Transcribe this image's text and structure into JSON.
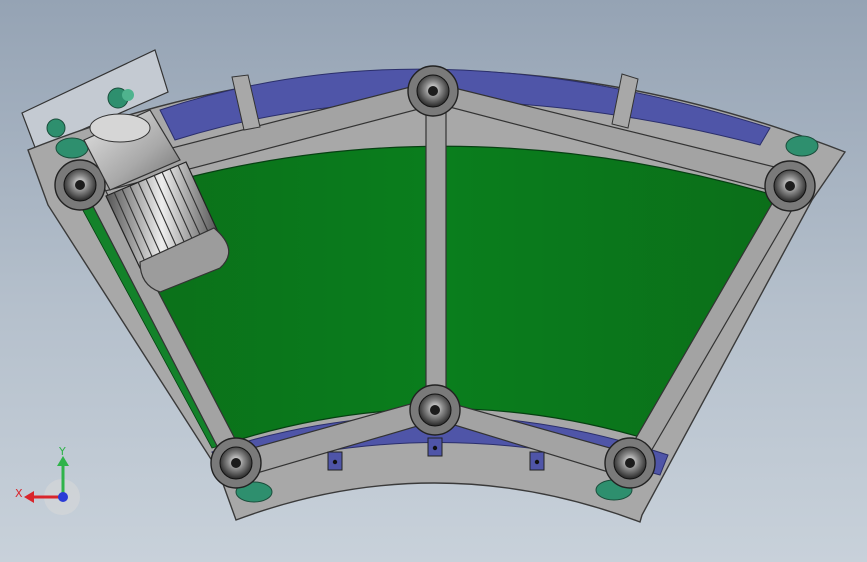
{
  "viewport": {
    "background_top": "#95a3b4",
    "background_bottom": "#c8d1da"
  },
  "model": {
    "type": "curved-belt-conveyor",
    "belt_color": "#0a7a1c",
    "frame_color": "#a6a6a6",
    "guide_color": "#4f55a8",
    "motor_color": "#b8b8b8",
    "bearing_color": "#2e8f6e"
  },
  "triad": {
    "x_label": "X",
    "y_label": "Y",
    "x_color": "#d9252b",
    "y_color": "#2fb34a",
    "z_color": "#2a3bd6"
  }
}
